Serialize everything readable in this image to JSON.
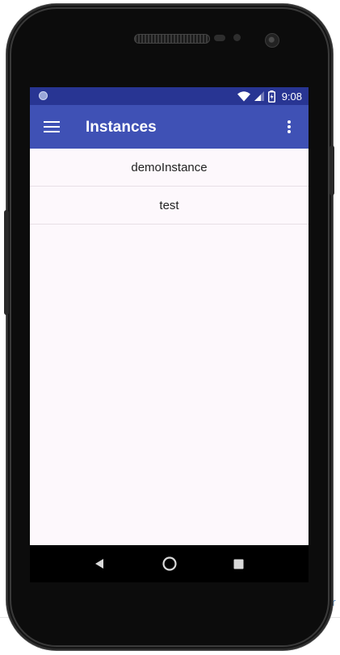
{
  "status_bar": {
    "time": "9:08"
  },
  "app_bar": {
    "title": "Instances"
  },
  "instances": [
    {
      "label": "demoInstance"
    },
    {
      "label": "test"
    }
  ],
  "page_edge_text": "or",
  "colors": {
    "status_bar": "#283593",
    "app_bar": "#3f51b5",
    "screen_background": "#fdf8fc",
    "nav_bar": "#000000"
  },
  "icons": {
    "status": [
      "notification-dot-icon",
      "wifi-icon",
      "signal-icon",
      "battery-icon"
    ],
    "app_bar": [
      "hamburger-menu-icon",
      "more-vert-icon"
    ],
    "nav_bar": [
      "back-triangle-icon",
      "home-circle-icon",
      "recents-square-icon"
    ]
  }
}
